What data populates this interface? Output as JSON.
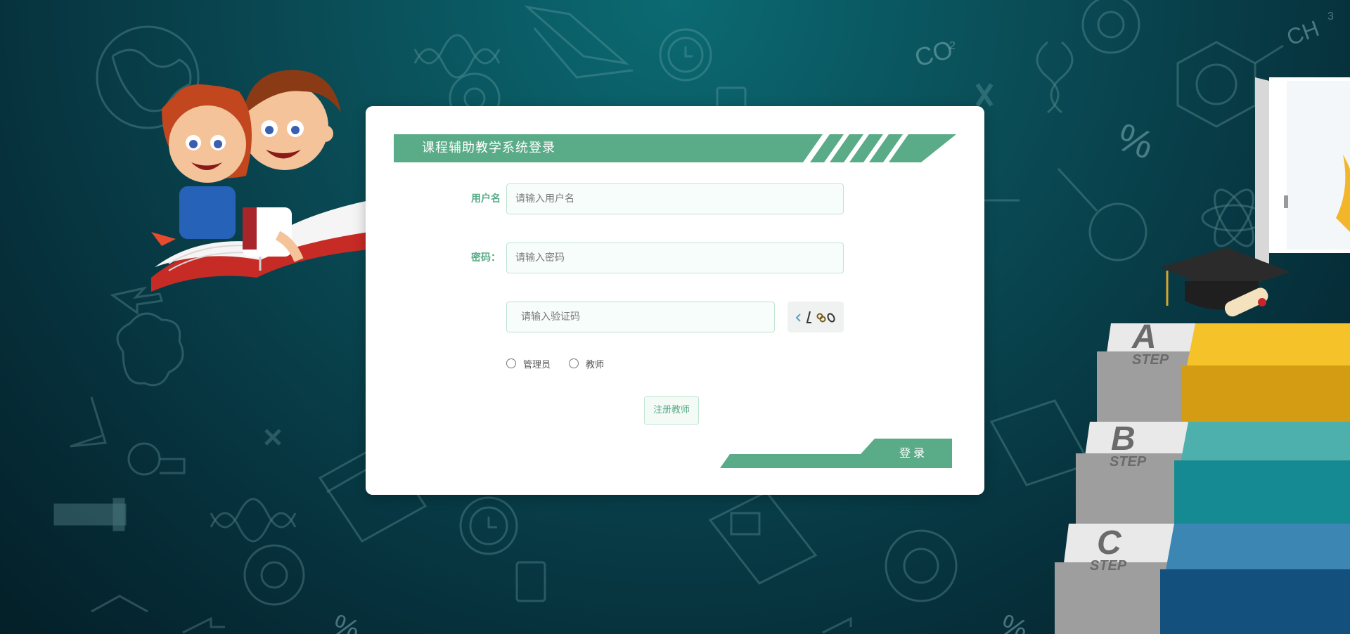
{
  "header": {
    "title": "课程辅助教学系统登录"
  },
  "form": {
    "username": {
      "label": "用户名",
      "placeholder": "请输入用户名"
    },
    "password": {
      "label": "密码：",
      "placeholder": "请输入密码"
    },
    "captcha": {
      "placeholder": "请输入验证码",
      "image_text": "<L%0"
    },
    "roles": [
      {
        "label": "管理员",
        "selected": false
      },
      {
        "label": "教师",
        "selected": false
      }
    ],
    "register_label": "注册教师",
    "login_label": "登录"
  },
  "steps": [
    {
      "letter": "A",
      "word": "STEP"
    },
    {
      "letter": "B",
      "word": "STEP"
    },
    {
      "letter": "C",
      "word": "STEP"
    }
  ],
  "background_symbols": {
    "co2": "CO",
    "co2_sub": "2",
    "ch3": "CH",
    "ch3_sub": "3",
    "percent": "%"
  },
  "colors": {
    "accent": "#5aab87",
    "background": "#0a4e58",
    "card": "#ffffff"
  }
}
